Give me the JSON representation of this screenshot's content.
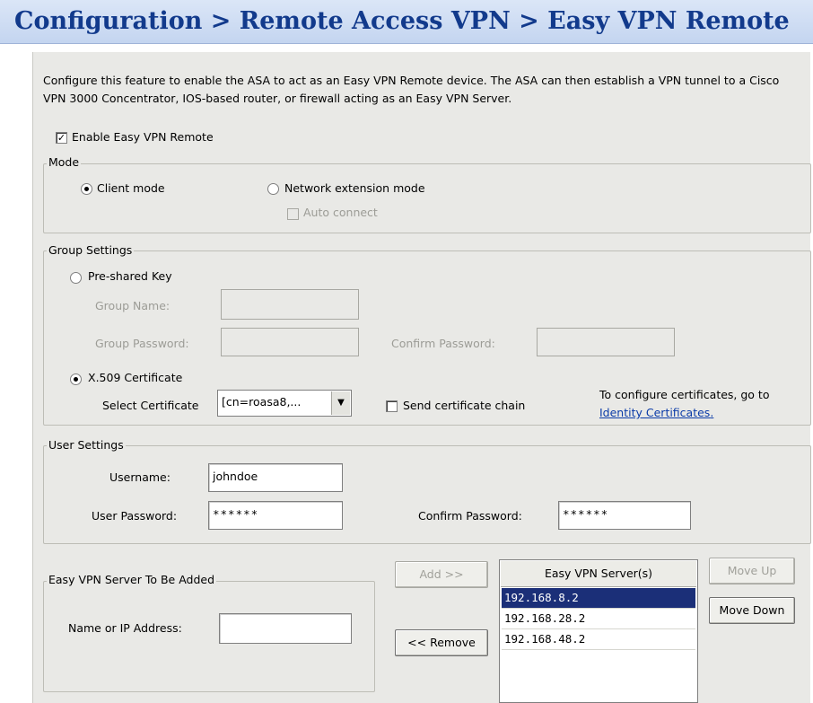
{
  "header": {
    "title": "Configuration > Remote Access VPN > Easy VPN Remote"
  },
  "description": "Configure this feature to enable the ASA to act as an Easy VPN Remote device. The ASA can then establish a VPN tunnel to a Cisco VPN 3000 Concentrator, IOS-based router, or firewall acting as an Easy VPN Server.",
  "enable": {
    "label": "Enable Easy VPN Remote",
    "checked": true
  },
  "mode": {
    "legend": "Mode",
    "client_label": "Client mode",
    "network_label": "Network extension mode",
    "auto_connect_label": "Auto connect",
    "selected": "Client mode"
  },
  "group_settings": {
    "legend": "Group Settings",
    "psk_label": "Pre-shared Key",
    "group_name_label": "Group Name:",
    "group_password_label": "Group Password:",
    "confirm_password_label": "Confirm Password:",
    "x509_label": "X.509 Certificate",
    "select_cert_label": "Select Certificate",
    "select_cert_value": "[cn=roasa8,...",
    "send_chain_label": "Send certificate chain",
    "configure_note": "To configure certificates, go to",
    "identity_link": "Identity Certificates",
    "identity_link_suffix": "."
  },
  "user_settings": {
    "legend": "User Settings",
    "username_label": "Username:",
    "username_value": "johndoe",
    "user_password_label": "User Password:",
    "user_password_value": "******",
    "confirm_password_label": "Confirm Password:",
    "confirm_password_value": "******"
  },
  "server_add": {
    "legend": "Easy VPN Server To Be Added",
    "name_label": "Name or IP Address:"
  },
  "buttons": {
    "add": "Add >>",
    "remove": "<< Remove",
    "move_up": "Move Up",
    "move_down": "Move Down"
  },
  "servers": {
    "header": "Easy VPN Server(s)",
    "items": [
      "192.168.8.2",
      "192.168.28.2",
      "192.168.48.2"
    ],
    "selected": "192.168.8.2"
  },
  "colors": {
    "title_text": "#123a8c",
    "title_bg": "#c4d5f0",
    "panel_bg": "#e9e9e6",
    "selection": "#1b2f78",
    "link": "#0b3ba8"
  }
}
